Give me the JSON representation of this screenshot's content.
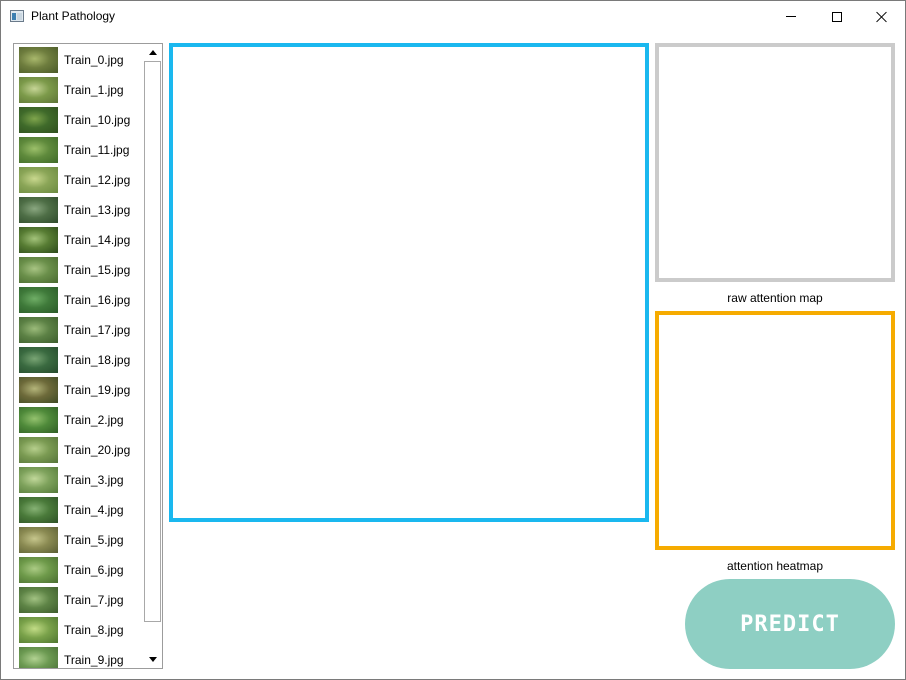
{
  "window": {
    "title": "Plant Pathology"
  },
  "file_list": {
    "items": [
      {
        "label": "Train_0.jpg",
        "thumb": "leaf-thumbnail",
        "colors": [
          "#6e7d3e",
          "#a9b86c",
          "#4a5a28"
        ]
      },
      {
        "label": "Train_1.jpg",
        "thumb": "leaf-thumbnail",
        "colors": [
          "#7c9a4a",
          "#c6d596",
          "#5d7436"
        ]
      },
      {
        "label": "Train_10.jpg",
        "thumb": "leaf-thumbnail",
        "colors": [
          "#3f6a2a",
          "#7fa54c",
          "#2f4f1e"
        ]
      },
      {
        "label": "Train_11.jpg",
        "thumb": "leaf-thumbnail",
        "colors": [
          "#5f8a3c",
          "#9cc06a",
          "#3f6a28"
        ]
      },
      {
        "label": "Train_12.jpg",
        "thumb": "leaf-thumbnail",
        "colors": [
          "#8aa557",
          "#c9d88e",
          "#6b8a40"
        ]
      },
      {
        "label": "Train_13.jpg",
        "thumb": "leaf-thumbnail",
        "colors": [
          "#4e6e46",
          "#8aa780",
          "#2f4b2c"
        ]
      },
      {
        "label": "Train_14.jpg",
        "thumb": "leaf-thumbnail",
        "colors": [
          "#577c33",
          "#a3c37a",
          "#2c4a1a"
        ]
      },
      {
        "label": "Train_15.jpg",
        "thumb": "leaf-thumbnail",
        "colors": [
          "#6a8f4a",
          "#a8c483",
          "#4a6a30"
        ]
      },
      {
        "label": "Train_16.jpg",
        "thumb": "leaf-thumbnail",
        "colors": [
          "#3f7a3a",
          "#6fae66",
          "#2a5a28"
        ]
      },
      {
        "label": "Train_17.jpg",
        "thumb": "leaf-thumbnail",
        "colors": [
          "#5c8145",
          "#9bbb7a",
          "#3d5e2c"
        ]
      },
      {
        "label": "Train_18.jpg",
        "thumb": "leaf-thumbnail",
        "colors": [
          "#3a6a40",
          "#79a574",
          "#254a2c"
        ]
      },
      {
        "label": "Train_19.jpg",
        "thumb": "leaf-thumbnail",
        "colors": [
          "#6d6a3a",
          "#b4b57a",
          "#3f4a24"
        ]
      },
      {
        "label": "Train_2.jpg",
        "thumb": "leaf-thumbnail",
        "colors": [
          "#4f8a3a",
          "#94c26e",
          "#2f5e24"
        ]
      },
      {
        "label": "Train_20.jpg",
        "thumb": "leaf-thumbnail",
        "colors": [
          "#7a9a52",
          "#b6cf8c",
          "#56743a"
        ]
      },
      {
        "label": "Train_3.jpg",
        "thumb": "leaf-thumbnail",
        "colors": [
          "#7ea25c",
          "#c1d89a",
          "#557a3a"
        ]
      },
      {
        "label": "Train_4.jpg",
        "thumb": "leaf-thumbnail",
        "colors": [
          "#4a7a3a",
          "#86b274",
          "#2e5226"
        ]
      },
      {
        "label": "Train_5.jpg",
        "thumb": "leaf-thumbnail",
        "colors": [
          "#8a8a52",
          "#c6c68c",
          "#5a5e34"
        ]
      },
      {
        "label": "Train_6.jpg",
        "thumb": "leaf-thumbnail",
        "colors": [
          "#6e9a4a",
          "#abcb84",
          "#4a6e30"
        ]
      },
      {
        "label": "Train_7.jpg",
        "thumb": "leaf-thumbnail",
        "colors": [
          "#5e8446",
          "#a2c282",
          "#3d5c2c"
        ]
      },
      {
        "label": "Train_8.jpg",
        "thumb": "leaf-thumbnail",
        "colors": [
          "#7aa24a",
          "#c2dc86",
          "#4f7630"
        ]
      },
      {
        "label": "Train_9.jpg",
        "thumb": "leaf-thumbnail",
        "colors": [
          "#6c9a52",
          "#b2d292",
          "#486e36"
        ]
      }
    ]
  },
  "panels": {
    "main_border_color": "#1ab8ef",
    "raw_border_color": "#cbcbcb",
    "heat_border_color": "#f6ab00",
    "raw_label": "raw attention map",
    "heat_label": "attention heatmap"
  },
  "predict": {
    "label": "PREDICT",
    "color": "#8ecfc3"
  }
}
